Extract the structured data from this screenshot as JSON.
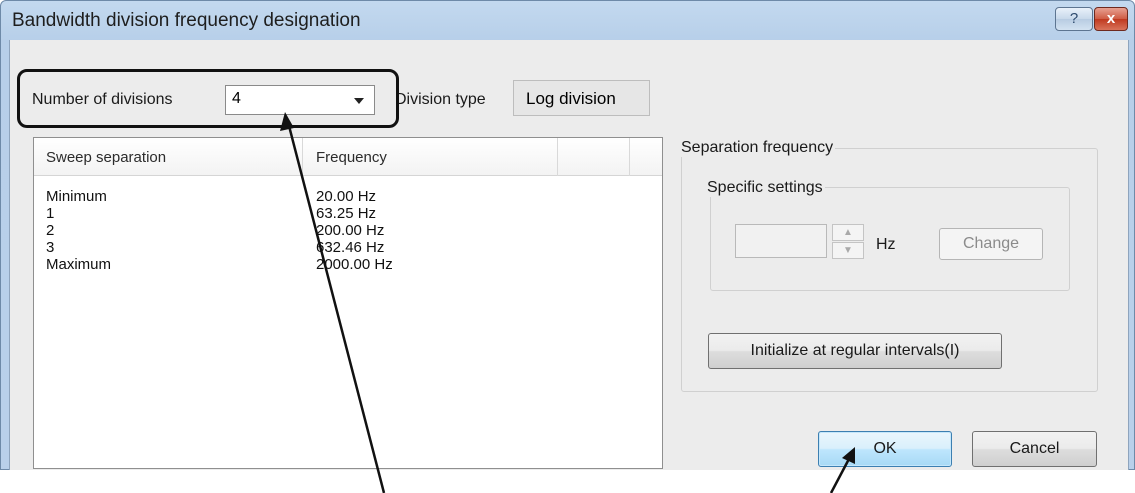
{
  "window": {
    "title": "Bandwidth division frequency designation",
    "help_label": "?",
    "close_label": "x"
  },
  "divisions": {
    "label": "Number of divisions",
    "value": "4",
    "type_label": "Division type",
    "type_value": "Log division"
  },
  "list": {
    "columns": [
      "Sweep separation",
      "Frequency",
      ""
    ],
    "rows": [
      {
        "separation": "Minimum",
        "frequency": "20.00 Hz"
      },
      {
        "separation": "1",
        "frequency": "63.25 Hz"
      },
      {
        "separation": "2",
        "frequency": "200.00 Hz"
      },
      {
        "separation": "3",
        "frequency": "632.46 Hz"
      },
      {
        "separation": "Maximum",
        "frequency": "2000.00 Hz"
      }
    ]
  },
  "separation": {
    "group_title": "Separation frequency",
    "specific_title": "Specific settings",
    "frequency_value": "",
    "unit": "Hz",
    "change_label": "Change",
    "init_label": "Initialize at regular intervals(I)"
  },
  "footer": {
    "ok_label": "OK",
    "cancel_label": "Cancel"
  },
  "icons": {
    "dropdown": "chevron-down-icon",
    "spin_up": "spin-up-icon",
    "spin_down": "spin-down-icon",
    "help": "help-icon",
    "close": "close-icon"
  }
}
